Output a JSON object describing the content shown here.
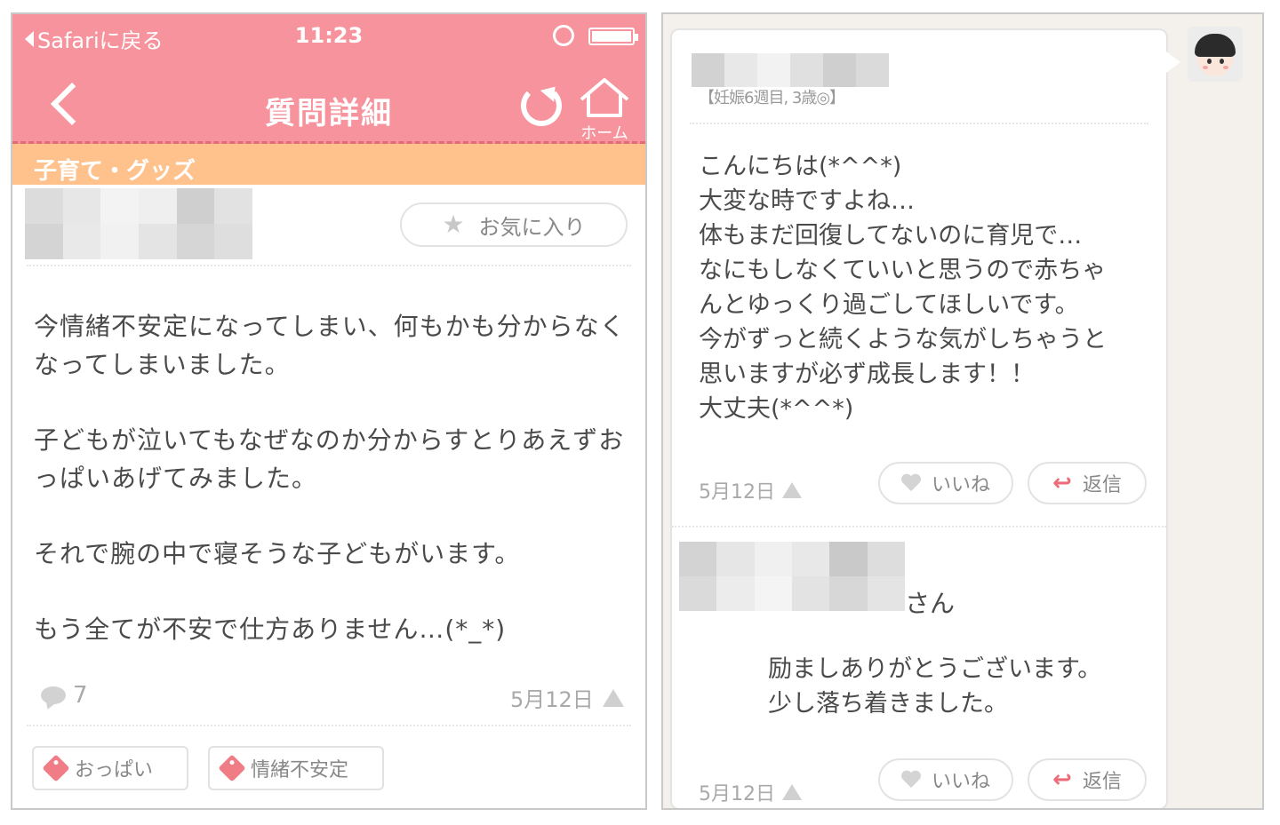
{
  "left": {
    "statusbar": {
      "back_label": "Safariに戻る",
      "time": "11:23"
    },
    "navbar": {
      "title": "質問詳細",
      "home_label": "ホーム"
    },
    "category": "子育て・グッズ",
    "favorite_label": "お気に入り",
    "question_paragraphs": [
      "今情緒不安定になってしまい、何もかも分からなくなってしまいました。",
      "子どもが泣いてもなぜなのか分からすとりあえずおっぱいあげてみました。",
      "それで腕の中で寝そうな子どもがいます。",
      "もう全てが不安で仕方ありません…(*_*)"
    ],
    "comment_count": "7",
    "date": "5月12日",
    "tags": [
      "おっぱい",
      "情緒不安定"
    ]
  },
  "right": {
    "profile_info": "【妊娠6週目, 3歳◎】",
    "answer_lines": [
      "こんにちは(*^^*)",
      "大変な時ですよね…",
      "体もまだ回復してないのに育児で…",
      "なにもしなくていいと思うので赤ちゃ",
      "んとゆっくり過ごしてほしいです。",
      "今がずっと続くような気がしちゃうと",
      "思いますが必ず成長します！！",
      "大丈夫(*^^*)"
    ],
    "answer_date": "5月12日",
    "like_label": "いいね",
    "reply_label": "返信",
    "reply_name_suffix": "さん",
    "reply_lines": [
      "励ましありがとうございます。",
      "少し落ち着きました。"
    ],
    "reply_date": "5月12日",
    "reply_like_label": "いいね",
    "reply_reply_label": "返信"
  },
  "colors": {
    "header_pink": "#f7939c",
    "category_orange": "#ffc28c",
    "accent_red": "#ee6b78",
    "panel_beige": "#f4f1ec"
  }
}
